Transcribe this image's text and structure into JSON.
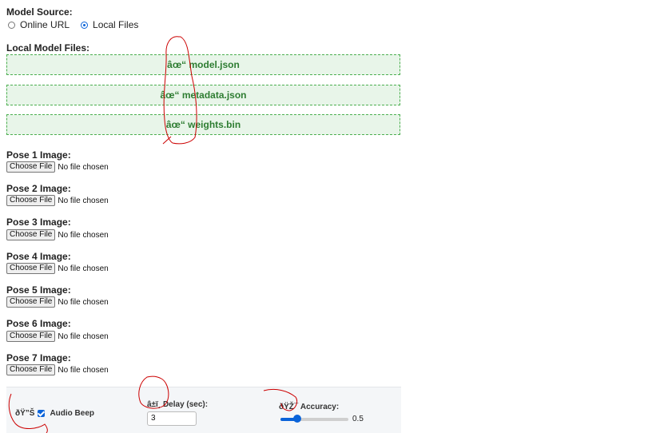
{
  "model_source": {
    "title": "Model Source:",
    "options": [
      {
        "label": "Online URL",
        "selected": false
      },
      {
        "label": "Local Files",
        "selected": true
      }
    ]
  },
  "local_files": {
    "title": "Local Model Files:",
    "files": [
      {
        "label": "âœ“ model.json"
      },
      {
        "label": "âœ“ metadata.json"
      },
      {
        "label": "âœ“ weights.bin"
      }
    ]
  },
  "poses": [
    {
      "label": "Pose 1 Image:",
      "button": "Choose File",
      "status": "No file chosen"
    },
    {
      "label": "Pose 2 Image:",
      "button": "Choose File",
      "status": "No file chosen"
    },
    {
      "label": "Pose 3 Image:",
      "button": "Choose File",
      "status": "No file chosen"
    },
    {
      "label": "Pose 4 Image:",
      "button": "Choose File",
      "status": "No file chosen"
    },
    {
      "label": "Pose 5 Image:",
      "button": "Choose File",
      "status": "No file chosen"
    },
    {
      "label": "Pose 6 Image:",
      "button": "Choose File",
      "status": "No file chosen"
    },
    {
      "label": "Pose 7 Image:",
      "button": "Choose File",
      "status": "No file chosen"
    }
  ],
  "settings": {
    "audio": {
      "icon_text": "ðŸ”Š",
      "label": "Audio Beep",
      "checked": true
    },
    "delay": {
      "icon_text": "â±ï¸",
      "label": "Delay (sec):",
      "value": "3"
    },
    "accuracy": {
      "icon_text": "ðŸŽ¯",
      "label": "Accuracy:",
      "value": 0.5,
      "min": 0,
      "max": 1,
      "value_text": "0.5"
    }
  },
  "colors": {
    "accent": "#0a63d9",
    "file_box_border": "#4caf50",
    "file_box_bg": "#e8f5e9",
    "file_box_text": "#2e7d32",
    "annotation": "#cc0000"
  }
}
